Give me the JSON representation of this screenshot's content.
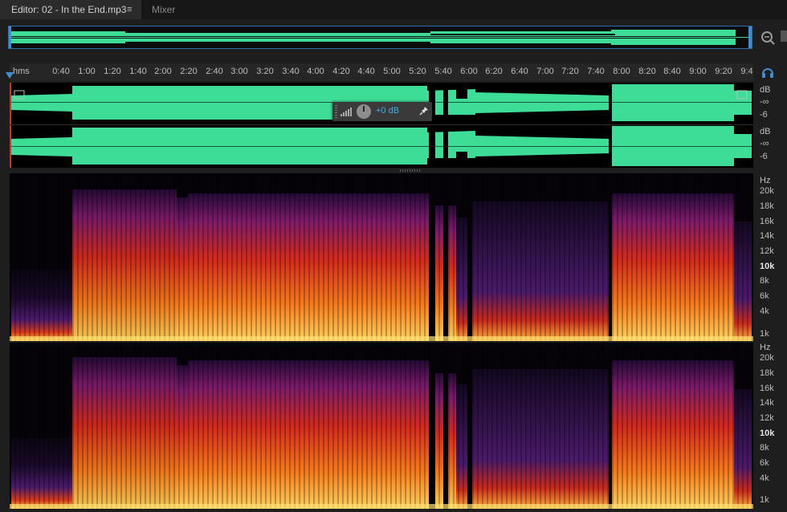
{
  "tabs": [
    {
      "label": "Editor: 02 - In the End.mp3",
      "active": true
    },
    {
      "label": "Mixer",
      "active": false
    }
  ],
  "tab_menu_glyph": "≡",
  "ruler": {
    "unit": "hms",
    "ticks": [
      "0:40",
      "1:00",
      "1:20",
      "1:40",
      "2:00",
      "2:20",
      "2:40",
      "3:00",
      "3:20",
      "3:40",
      "4:00",
      "4:20",
      "4:40",
      "5:00",
      "5:20",
      "5:40",
      "6:00",
      "6:20",
      "6:40",
      "7:00",
      "7:20",
      "7:40",
      "8:00",
      "8:20",
      "8:40",
      "9:00",
      "9:20",
      "9:4"
    ]
  },
  "hud": {
    "value": "+0 dB"
  },
  "db_scale": {
    "unit": "dB",
    "labels": [
      "-∞",
      "-6"
    ]
  },
  "hz_scale": {
    "unit": "Hz",
    "labels": [
      "20k",
      "18k",
      "16k",
      "14k",
      "12k",
      "10k",
      "8k",
      "6k",
      "4k",
      "1k"
    ]
  },
  "colors": {
    "waveform": "#3ddc97",
    "accent": "#3c8fd6",
    "spectral_low": "#ffd15a",
    "spectral_mid": "#e8401a",
    "spectral_high": "#6a1b7a"
  },
  "icons": {
    "zoom": "zoom-icon",
    "headphones": "headphone-icon",
    "pin": "pin-icon",
    "meter": "meter-icon"
  }
}
